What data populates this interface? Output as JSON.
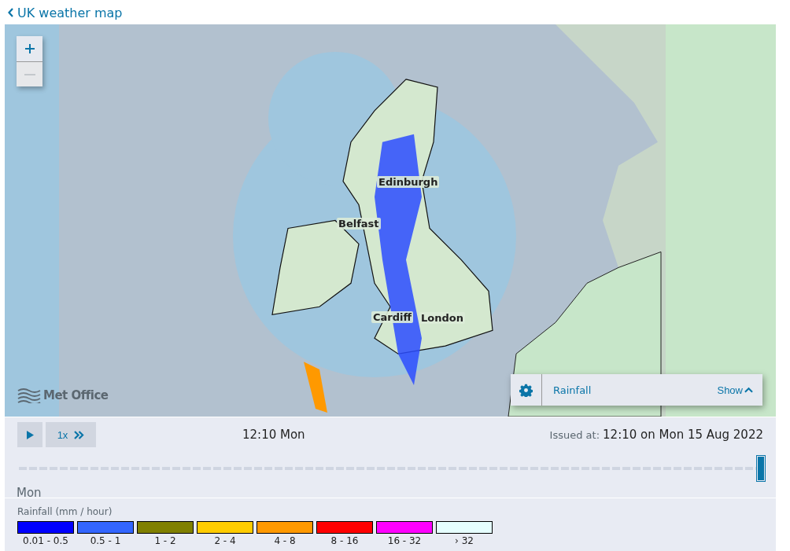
{
  "header": {
    "back_link": "UK weather map"
  },
  "map": {
    "cities": [
      {
        "name": "Edinburgh"
      },
      {
        "name": "Belfast"
      },
      {
        "name": "Cardiff"
      },
      {
        "name": "London"
      }
    ],
    "logo": "Met Office",
    "layer_panel": {
      "layer": "Rainfall",
      "toggle": "Show"
    }
  },
  "controls": {
    "speed": "1x",
    "time": "12:10 Mon",
    "issued_label": "Issued at:",
    "issued_value": "12:10 on Mon 15 Aug 2022",
    "timeline": {
      "level": 1.0
    },
    "day": "Mon"
  },
  "legend": {
    "title": "Rainfall (mm / hour)",
    "items": [
      {
        "label": "0.01 - 0.5",
        "color": "#0000ff"
      },
      {
        "label": "0.5 - 1",
        "color": "#3366ff"
      },
      {
        "label": "1 - 2",
        "color": "#808000"
      },
      {
        "label": "2 - 4",
        "color": "#ffcc00"
      },
      {
        "label": "4 - 8",
        "color": "#ff9900"
      },
      {
        "label": "8 - 16",
        "color": "#ff0000"
      },
      {
        "label": "16 - 32",
        "color": "#ff00ff"
      },
      {
        "label": "› 32",
        "color": "#e6ffff"
      }
    ]
  }
}
